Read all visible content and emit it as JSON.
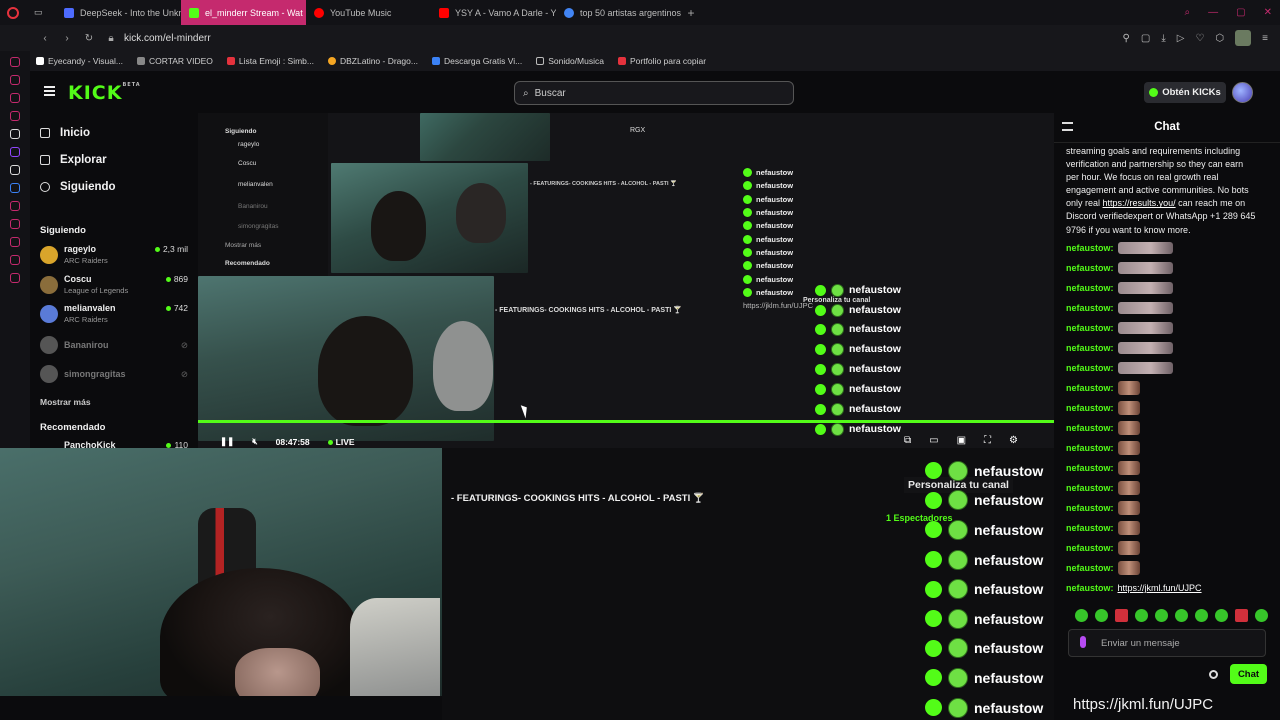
{
  "browser": {
    "tabs": [
      {
        "label": "DeepSeek - Into the Unkn",
        "color": "#4d6bfe"
      },
      {
        "label": "el_minderr Stream - Wat",
        "color": "#53fc18",
        "active": true
      },
      {
        "label": "YouTube Music",
        "color": "#ff0000"
      },
      {
        "label": "YSY A - Vamo A Darle - Y",
        "color": "#ff0000"
      },
      {
        "label": "top 50 artistas argentinos",
        "color": "#4285f4"
      }
    ],
    "url": "kick.com/el-minderr",
    "bookmarks": [
      {
        "label": "Eyecandy - Visual...",
        "color": "#ffffff"
      },
      {
        "label": "CORTAR VIDEO",
        "color": "#888888"
      },
      {
        "label": "Lista Emoji : Simb...",
        "color": "#e5323d"
      },
      {
        "label": "DBZLatino - Drago...",
        "color": "#f5a623"
      },
      {
        "label": "Descarga Gratis Vi...",
        "color": "#3b82f6"
      },
      {
        "label": "Sonido/Musica",
        "color": "#bbbbbb"
      },
      {
        "label": "Portfolio para copiar",
        "color": "#e5323d"
      }
    ]
  },
  "kick": {
    "logo": "KICK",
    "logo_badge": "BETA",
    "search_placeholder": "Buscar",
    "kicks_button": "Obtén KICKs",
    "nav": [
      {
        "label": "Inicio",
        "icon": "home-icon"
      },
      {
        "label": "Explorar",
        "icon": "compass-icon"
      },
      {
        "label": "Siguiendo",
        "icon": "heart-icon"
      }
    ],
    "following_heading": "Siguiendo",
    "following": [
      {
        "name": "rageylo",
        "game": "ARC Raiders",
        "viewers": "2,3 mil",
        "color": "#d9a52b"
      },
      {
        "name": "Coscu",
        "game": "League of Legends",
        "viewers": "869",
        "color": "#8a6d3b"
      },
      {
        "name": "melianvalen",
        "game": "ARC Raiders",
        "viewers": "742",
        "color": "#5a7bd8"
      },
      {
        "name": "Bananirou",
        "game": "",
        "viewers": "",
        "color": "#555555"
      },
      {
        "name": "simongragitas",
        "game": "",
        "viewers": "",
        "color": "#555555"
      }
    ],
    "show_more": "Mostrar más",
    "recommended_heading": "Recomendado",
    "recommended_peek": {
      "name": "PanchoKick",
      "viewers": "110"
    }
  },
  "player": {
    "time": "08:47:58",
    "live": "LIVE",
    "stream_title": "- FEATURINGS- COOKINGS HITS - ALCOHOL - PASTI 🍸",
    "overlay_label": "RGX"
  },
  "chat": {
    "title": "Chat",
    "spam_lines": [
      "streaming goals and requirements including",
      "verification and partnership so they can earn",
      "per hour. We focus on real growth real",
      "engagement and active communities. No bots",
      "only real",
      "can reach me on",
      "Discord verifiedexpert or WhatsApp +1 289 645",
      "9796 if you want to know more."
    ],
    "spam_link": "https://results.you/",
    "username": "nefaustow:",
    "link_message": "https://jkml.fun/UJPC",
    "input_placeholder": "Enviar un mensaje",
    "send_button": "Chat"
  },
  "echo": {
    "username": "nefaustow",
    "personaliza": "Personaliza tu canal",
    "espectadores": "1 Espectadores",
    "url_overlay": "https://jkml.fun/UJPC",
    "url_small": "https://jklm.fun/UJPC"
  }
}
